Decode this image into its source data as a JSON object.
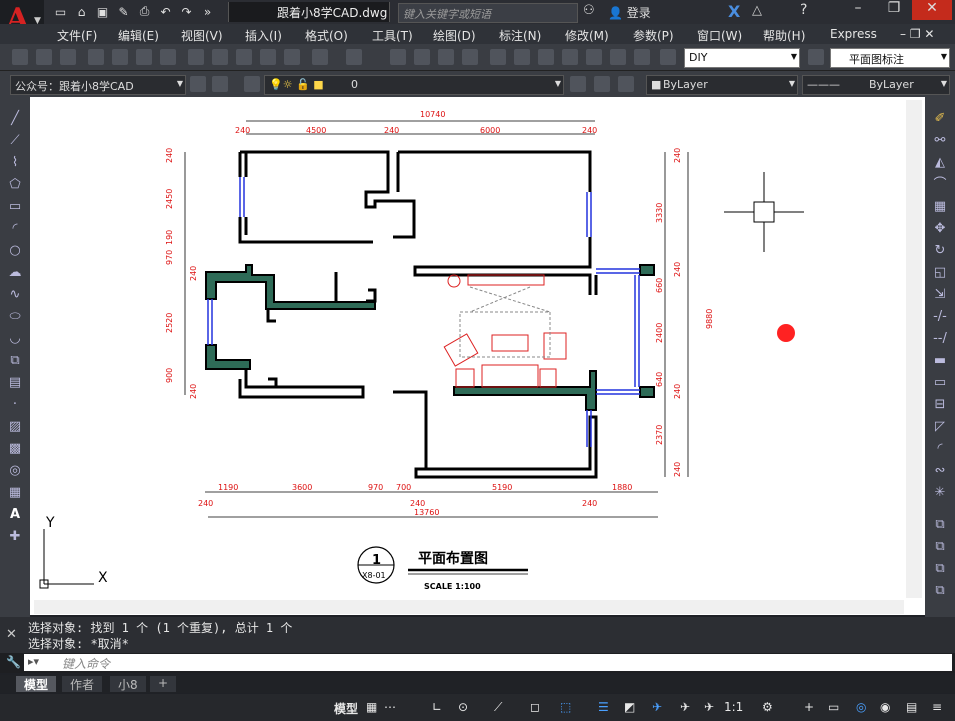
{
  "app": {
    "doc_title": "跟着小8学CAD.dwg",
    "search_placeholder": "键入关键字或短语",
    "login": "登录",
    "express": "Express"
  },
  "menu": [
    "文件(F)",
    "编辑(E)",
    "视图(V)",
    "插入(I)",
    "格式(O)",
    "工具(T)",
    "绘图(D)",
    "标注(N)",
    "修改(M)",
    "参数(P)",
    "窗口(W)",
    "帮助(H)",
    "Express"
  ],
  "toolbar": {
    "dimstyle": "DIY",
    "textstyle": "平面图标注"
  },
  "layers": {
    "workspace": "公众号：跟着小8学CAD",
    "current_layer": "0",
    "color": "ByLayer",
    "linetype": "ByLayer"
  },
  "drawing": {
    "dims_top": [
      "10740",
      "240",
      "4500",
      "240",
      "6000",
      "240"
    ],
    "dims_bottom": [
      "1190",
      "3600",
      "970",
      "700",
      "5190",
      "1880",
      "240",
      "240",
      "240",
      "13760"
    ],
    "dims_left": [
      "240",
      "2450",
      "190",
      "970",
      "240",
      "2520",
      "900",
      "240"
    ],
    "dims_right": [
      "240",
      "3330",
      "240",
      "660",
      "2400",
      "640",
      "240",
      "2370",
      "240",
      "9880"
    ],
    "title_number": "1",
    "title_ref": "X8-01",
    "title_text": "平面布置图",
    "scale_text": "SCALE 1:100"
  },
  "ucs": {
    "x": "X",
    "y": "Y"
  },
  "command": {
    "line1": "选择对象: 找到 1 个 (1 个重复), 总计 1 个",
    "line2": "选择对象: *取消*",
    "input_placeholder": "键入命令"
  },
  "layout_tabs": [
    "模型",
    "作者",
    "小8",
    "+"
  ],
  "status": {
    "model": "模型",
    "scale": "1:1"
  },
  "colors": {
    "wall_fill": "#2e6b57",
    "dim_red": "#dd1111",
    "window_blue": "#2233dd"
  }
}
